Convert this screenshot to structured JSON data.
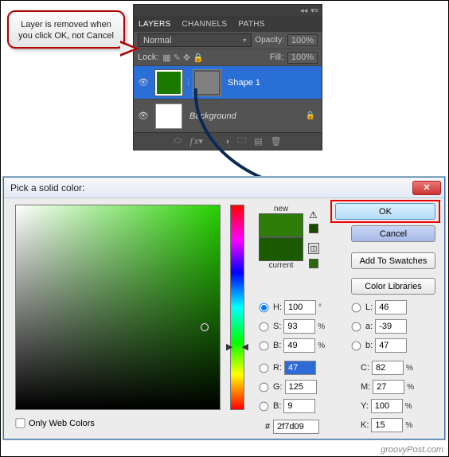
{
  "callout": {
    "text": "Layer is removed when you click OK, not Cancel"
  },
  "layers_panel": {
    "tabs": [
      "LAYERS",
      "CHANNELS",
      "PATHS"
    ],
    "blend_mode": "Normal",
    "opacity_label": "Opacity:",
    "opacity_value": "100%",
    "lock_label": "Lock:",
    "fill_label": "Fill:",
    "fill_value": "100%",
    "layers": [
      {
        "name": "Shape 1",
        "selected": true
      },
      {
        "name": "Background",
        "selected": false
      }
    ]
  },
  "color_picker": {
    "title": "Pick a solid color:",
    "ok": "OK",
    "cancel": "Cancel",
    "add_swatches": "Add To Swatches",
    "color_libraries": "Color Libraries",
    "new_label": "new",
    "current_label": "current",
    "only_web": "Only Web Colors",
    "hex_label": "#",
    "hex_value": "2f7d09",
    "H": {
      "label": "H:",
      "value": "100",
      "unit": "°"
    },
    "S": {
      "label": "S:",
      "value": "93",
      "unit": "%"
    },
    "Bv": {
      "label": "B:",
      "value": "49",
      "unit": "%"
    },
    "R": {
      "label": "R:",
      "value": "47"
    },
    "G": {
      "label": "G:",
      "value": "125"
    },
    "Bc": {
      "label": "B:",
      "value": "9"
    },
    "L": {
      "label": "L:",
      "value": "46"
    },
    "a": {
      "label": "a:",
      "value": "-39"
    },
    "b": {
      "label": "b:",
      "value": "47"
    },
    "C": {
      "label": "C:",
      "value": "82",
      "unit": "%"
    },
    "M": {
      "label": "M:",
      "value": "27",
      "unit": "%"
    },
    "Y": {
      "label": "Y:",
      "value": "100",
      "unit": "%"
    },
    "K": {
      "label": "K:",
      "value": "15",
      "unit": "%"
    }
  },
  "credit": "groovyPost.com"
}
